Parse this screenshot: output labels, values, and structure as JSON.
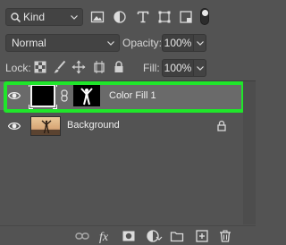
{
  "filter": {
    "kind_label": "Kind",
    "icons": [
      "image-filter-icon",
      "adjustment-filter-icon",
      "type-filter-icon",
      "shape-filter-icon",
      "smart-object-filter-icon"
    ]
  },
  "blend": {
    "mode": "Normal"
  },
  "opacity": {
    "label": "Opacity:",
    "value": "100%"
  },
  "lock": {
    "label": "Lock:",
    "icons": [
      "lock-transparent-icon",
      "lock-image-icon",
      "lock-position-icon",
      "artboard-lock-icon",
      "lock-all-icon"
    ]
  },
  "fill": {
    "label": "Fill:",
    "value": "100%"
  },
  "layers": [
    {
      "name": "Color Fill 1",
      "selected": true,
      "locked": false
    },
    {
      "name": "Background",
      "selected": false,
      "locked": true
    }
  ],
  "colors": {
    "highlight": "#1fe62a",
    "panel": "#535353",
    "selected_row": "#6a6a6a"
  },
  "bottom_bar": [
    "link-layers-icon",
    "fx-icon",
    "add-mask-icon",
    "adjustment-layer-icon",
    "new-group-icon",
    "new-layer-icon",
    "delete-layer-icon"
  ]
}
